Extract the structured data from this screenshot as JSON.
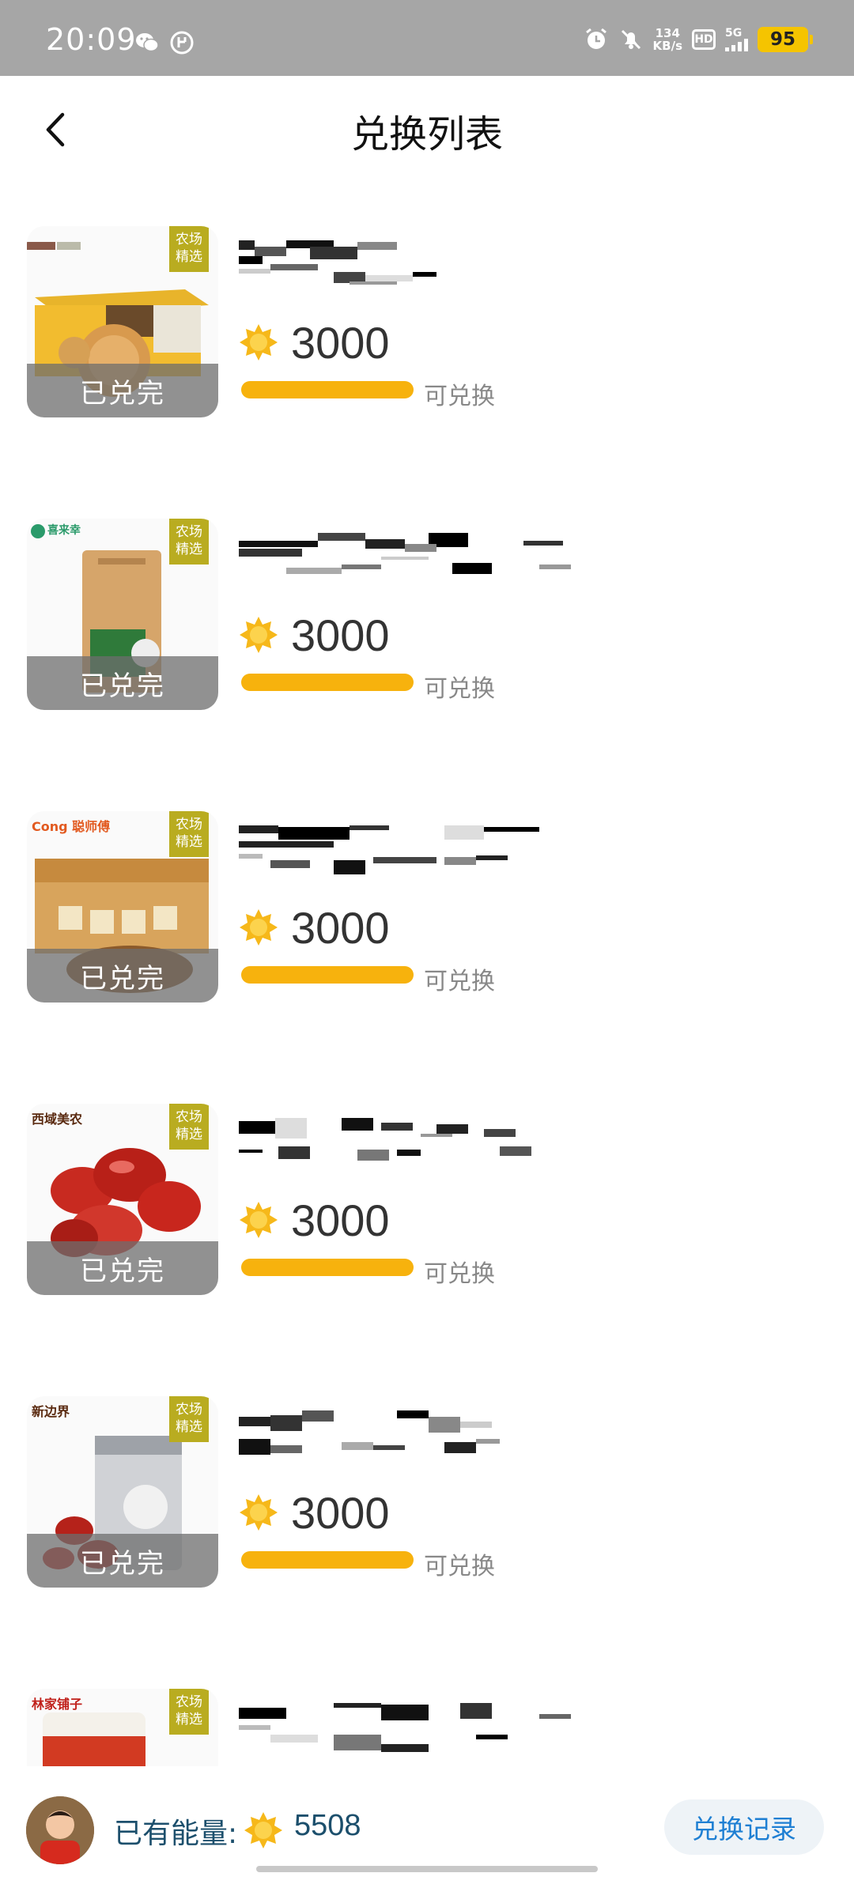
{
  "status_bar": {
    "time": "20:09",
    "net_speed_value": "134",
    "net_speed_unit": "KB/s",
    "hd_label": "HD",
    "network_label": "5G",
    "battery": "95",
    "icons": [
      "wechat-icon",
      "app-notification-icon",
      "alarm-icon",
      "mute-icon"
    ]
  },
  "header": {
    "title": "兑换列表",
    "back_icon": "chevron-left-icon"
  },
  "colors": {
    "accent_orange": "#f7b20d",
    "farm_tag": "#b9ac20",
    "link_blue": "#1e7fd3",
    "energy_text": "#1c4f6c"
  },
  "items": [
    {
      "brand": "",
      "tag": "农场精选",
      "overlay": "已兑完",
      "price": "3000",
      "status": "可兑换",
      "progress": 1.0,
      "product": "biscuit-box"
    },
    {
      "brand": "喜来幸",
      "tag": "农场精选",
      "overlay": "已兑完",
      "price": "3000",
      "status": "可兑换",
      "progress": 1.0,
      "product": "tea-bag"
    },
    {
      "brand": "Cong 聪师傅",
      "tag": "农场精选",
      "overlay": "已兑完",
      "price": "3000",
      "status": "可兑换",
      "progress": 1.0,
      "product": "snack-box"
    },
    {
      "brand": "西域美农",
      "tag": "农场精选",
      "overlay": "已兑完",
      "price": "3000",
      "status": "可兑换",
      "progress": 1.0,
      "product": "red-dates"
    },
    {
      "brand": "新边界",
      "tag": "农场精选",
      "overlay": "已兑完",
      "price": "3000",
      "status": "可兑换",
      "progress": 1.0,
      "product": "dates-bag"
    },
    {
      "brand": "林家铺子",
      "tag": "农场精选",
      "overlay": "",
      "price": "",
      "status": "",
      "progress": 0,
      "product": "canned-fruit"
    }
  ],
  "footer": {
    "energy_label": "已有能量:",
    "energy_value": "5508",
    "records_button": "兑换记录"
  }
}
